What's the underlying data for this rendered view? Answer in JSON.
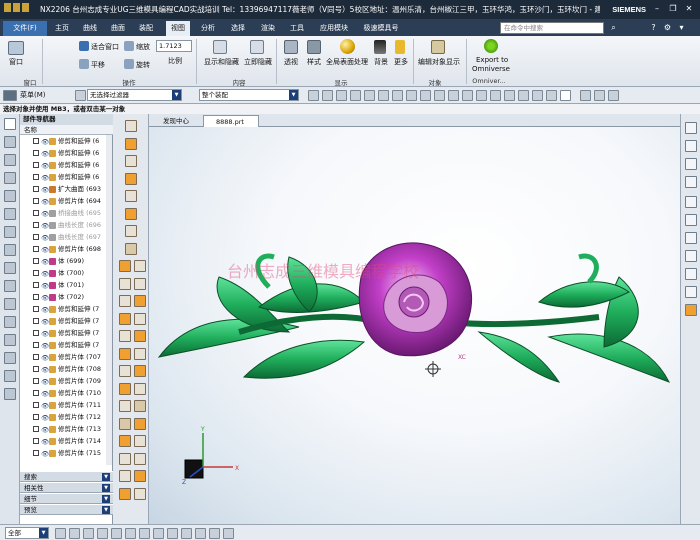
{
  "title_bar": {
    "title": "NX2206 台州志成专业UG三维模具编程CAD实战培训 Tel：13396947117薇老师（V同号）5校区地址：温州乐清，台州椒江三甲，玉环华鸿，玉环沙门，玉环坎门 - 建模",
    "brand": "SIEMENS",
    "minimize": "–",
    "restore": "❐",
    "close": "✕"
  },
  "menu": {
    "file": "文件(F)",
    "tabs": [
      "主页",
      "曲线",
      "曲面",
      "装配",
      "视图",
      "分析",
      "选择",
      "渲染",
      "工具",
      "应用模块",
      "极速模具号"
    ],
    "active_tab": "视图",
    "search_placeholder": "在命令中搜索"
  },
  "ribbon": {
    "window_label": "窗口",
    "fit_window": "适合窗口",
    "zoom": "缩放",
    "zoom_value": "1.7123",
    "pan": "平移",
    "rotate": "旋转",
    "scale": "比例",
    "show_hide": "显示和隐藏",
    "immediate_hide": "立即隐藏",
    "perspective": "透视",
    "style": "样式",
    "full_display": "全局表面处理",
    "background": "背景",
    "more": "更多",
    "edit_obj_display": "编辑对象显示",
    "export_omniverse_1": "Export to",
    "export_omniverse_2": "Omniverse",
    "groups": {
      "window": "窗口",
      "operation": "操作",
      "content": "内容",
      "display": "显示",
      "object": "对象",
      "omniverse": "Omniver..."
    }
  },
  "toolbar2": {
    "menu": "菜单(M)",
    "filter": "无选择过滤器",
    "assembly": "整个装配"
  },
  "status": "选择对象并使用 MB3，或者双击某一对象",
  "navigator": {
    "title": "部件导航器",
    "column": "名称",
    "rows": [
      {
        "label": "修剪和延伸 (6",
        "gray": false,
        "color": "#d9a340"
      },
      {
        "label": "修剪和延伸 (6",
        "gray": false,
        "color": "#d9a340"
      },
      {
        "label": "修剪和延伸 (6",
        "gray": false,
        "color": "#d9a340"
      },
      {
        "label": "修剪和延伸 (6",
        "gray": false,
        "color": "#d9a340"
      },
      {
        "label": "扩大曲面 (693",
        "gray": false,
        "color": "#c87a2d"
      },
      {
        "label": "修剪片体 (694",
        "gray": false,
        "color": "#d9a340"
      },
      {
        "label": "桥接曲线 (695",
        "gray": true,
        "color": "#a0a0a0"
      },
      {
        "label": "曲线长度 (696",
        "gray": true,
        "color": "#a0a0a0"
      },
      {
        "label": "曲线长度 (697",
        "gray": true,
        "color": "#a0a0a0"
      },
      {
        "label": "修剪片体 (698",
        "gray": false,
        "color": "#d9a340"
      },
      {
        "label": "体 (699)",
        "gray": false,
        "color": "#c03a8a"
      },
      {
        "label": "体 (700)",
        "gray": false,
        "color": "#c03a8a"
      },
      {
        "label": "体 (701)",
        "gray": false,
        "color": "#c03a8a"
      },
      {
        "label": "体 (702)",
        "gray": false,
        "color": "#c03a8a"
      },
      {
        "label": "修剪和延伸 (7",
        "gray": false,
        "color": "#d9a340"
      },
      {
        "label": "修剪和延伸 (7",
        "gray": false,
        "color": "#d9a340"
      },
      {
        "label": "修剪和延伸 (7",
        "gray": false,
        "color": "#d9a340"
      },
      {
        "label": "修剪和延伸 (7",
        "gray": false,
        "color": "#d9a340"
      },
      {
        "label": "修剪片体 (707",
        "gray": false,
        "color": "#d9a340"
      },
      {
        "label": "修剪片体 (708",
        "gray": false,
        "color": "#d9a340"
      },
      {
        "label": "修剪片体 (709",
        "gray": false,
        "color": "#d9a340"
      },
      {
        "label": "修剪片体 (710",
        "gray": false,
        "color": "#d9a340"
      },
      {
        "label": "修剪片体 (711",
        "gray": false,
        "color": "#d9a340"
      },
      {
        "label": "修剪片体 (712",
        "gray": false,
        "color": "#d9a340"
      },
      {
        "label": "修剪片体 (713",
        "gray": false,
        "color": "#d9a340"
      },
      {
        "label": "修剪片体 (714",
        "gray": false,
        "color": "#d9a340"
      },
      {
        "label": "修剪片体 (715",
        "gray": false,
        "color": "#d9a340"
      }
    ],
    "accordion": [
      "搜索",
      "相关性",
      "细节",
      "预览"
    ]
  },
  "doc_tabs": [
    "发现中心",
    "8888.prt"
  ],
  "viewport": {
    "watermark": "台州志成三维模具编程学校",
    "triad_x": "X",
    "triad_y": "Y",
    "triad_z": "Z",
    "xc_label": "XC",
    "colors": {
      "leaf_green": "#22b060",
      "rose_magenta": "#c23fc8"
    }
  },
  "bottom": {
    "filter": "全部"
  }
}
